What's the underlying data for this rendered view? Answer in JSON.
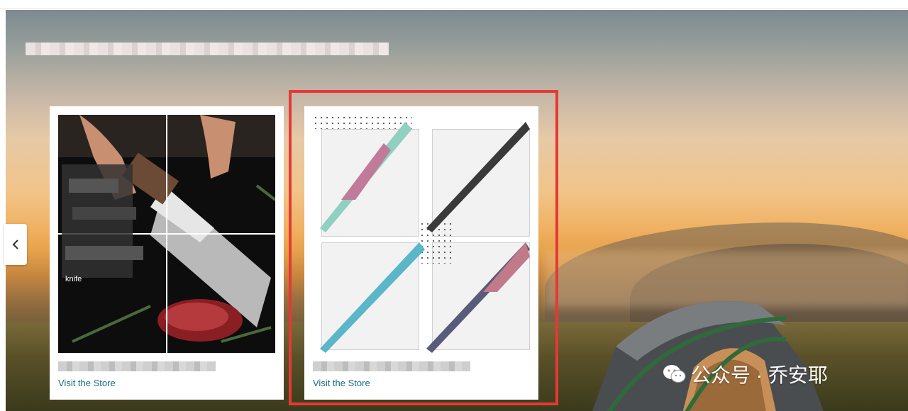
{
  "cards": [
    {
      "store_name": "",
      "link_label": "Visit the Store"
    },
    {
      "store_name": "",
      "link_label": "Visit the Store"
    }
  ],
  "card1_image": {
    "overlay_text": [
      "knife"
    ]
  },
  "watermark": {
    "text": "公众号 · 乔安耶"
  },
  "colors": {
    "highlight": "#e53935",
    "link": "#1a6a86"
  },
  "icons": {
    "carousel_prev": "chevron-left-icon",
    "watermark": "wechat-icon"
  }
}
